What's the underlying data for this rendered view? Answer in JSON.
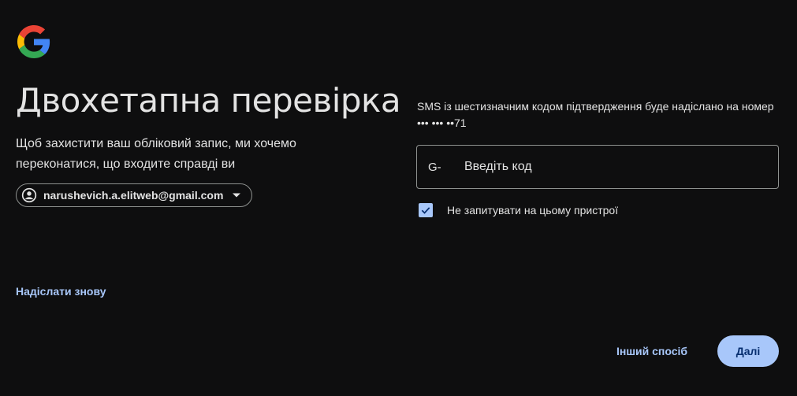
{
  "header": {
    "logo": "google-logo",
    "title": "Двохетапна перевірка",
    "subtitle": "Щоб захистити ваш обліковий запис, ми хочемо переконатися, що входите справді ви"
  },
  "account": {
    "icon": "account-circle-icon",
    "email": "narushevich.a.elitweb@gmail.com",
    "caret_icon": "caret-down-icon"
  },
  "resend_label": "Надіслати знову",
  "verification": {
    "info_line1": "SMS із шестизначним кодом підтвердження буде надіслано на номер",
    "info_line2": "••• ••• ••71",
    "code_prefix": "G-",
    "code_placeholder": "Введіть код",
    "code_value": "",
    "remember_label": "Не запитувати на цьому пристрої",
    "remember_checked": true
  },
  "actions": {
    "other_way_label": "Інший спосіб",
    "next_label": "Далі"
  },
  "colors": {
    "background": "#0e0e0f",
    "text": "#e3e3e3",
    "accent": "#a8c7fa",
    "button_text": "#062e6f",
    "border": "#8e918f"
  }
}
